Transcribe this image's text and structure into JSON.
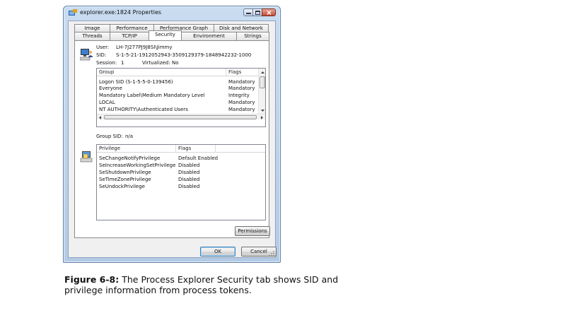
{
  "window": {
    "title": "explorer.exe:1824 Properties"
  },
  "tabs_back": [
    "Image",
    "Performance",
    "Performance Graph",
    "Disk and Network"
  ],
  "tabs_front": [
    "Threads",
    "TCP/IP",
    "Security",
    "Environment",
    "Strings"
  ],
  "active_tab": "Security",
  "identity": {
    "user_label": "User:",
    "user_value": "LH-7J277PJ9J8SI\\Jimmy",
    "sid_label": "SID:",
    "sid_value": "S-1-5-21-1912052943-3509129379-1848942232-1000",
    "session_label": "Session:",
    "session_value": "1",
    "virtualized_label": "Virtualized:",
    "virtualized_value": "No"
  },
  "groups": {
    "col_group": "Group",
    "col_flags": "Flags",
    "rows": [
      {
        "group": "Logon SID (S-1-5-5-0-139456)",
        "flags": "Mandatory"
      },
      {
        "group": "Everyone",
        "flags": "Mandatory"
      },
      {
        "group": "Mandatory Label\\Medium Mandatory Level",
        "flags": "Integrity"
      },
      {
        "group": "LOCAL",
        "flags": "Mandatory"
      },
      {
        "group": "NT AUTHORITY\\Authenticated Users",
        "flags": "Mandatory"
      }
    ],
    "group_sid_label": "Group SID:",
    "group_sid_value": "n/a"
  },
  "privileges": {
    "col_privilege": "Privilege",
    "col_flags": "Flags",
    "rows": [
      {
        "privilege": "SeChangeNotifyPrivilege",
        "flags": "Default Enabled"
      },
      {
        "privilege": "SeIncreaseWorkingSetPrivilege",
        "flags": "Disabled"
      },
      {
        "privilege": "SeShutdownPrivilege",
        "flags": "Disabled"
      },
      {
        "privilege": "SeTimeZonePrivilege",
        "flags": "Disabled"
      },
      {
        "privilege": "SeUndockPrivilege",
        "flags": "Disabled"
      }
    ]
  },
  "buttons": {
    "permissions": "Permissions",
    "ok": "OK",
    "cancel": "Cancel"
  },
  "caption": {
    "label": "Figure 6-8:",
    "text": "The Process Explorer Security tab shows SID and privilege information from process tokens."
  },
  "icons": [
    "app-icon",
    "minimize-icon",
    "maximize-icon",
    "close-icon",
    "user-computer-icon",
    "privilege-computer-icon",
    "scroll-up-icon",
    "scroll-down-icon",
    "scroll-left-icon",
    "scroll-right-icon",
    "size-grip-icon"
  ],
  "colors": {
    "frame": "#b4cbe6",
    "close_button": "#c64a36",
    "default_button_border": "#3c7fb1"
  }
}
